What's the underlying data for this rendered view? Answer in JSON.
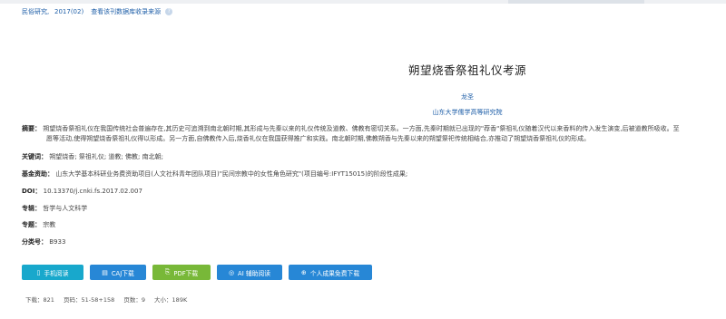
{
  "source": {
    "journal": "民俗研究",
    "issue": "2017(02)",
    "link": "查看该刊数据库收录来源"
  },
  "paper": {
    "title": "朔望烧香祭祖礼仪考源",
    "author": "龙圣",
    "affiliation": "山东大学儒学高等研究院"
  },
  "abstract": {
    "label": "摘要：",
    "line1": "朔望烧香祭祖礼仪在我国传统社会普遍存在,其历史可追溯到南北朝时期,其形成与先秦以来的礼仪传统及道教、佛教有密切关系。一方面,先秦时期就已出现的\"荐香\"祭祖礼仪随着汉代以来香料的传入发生演变,后被道教所吸收。至",
    "line2": "愿等活动,使得朔望烧香祭祖礼仪得以形成。另一方面,自佛教传入后,烧香礼仪在我国获得推广和实践。南北朝时期,佛教朔香与先秦以来的朔望祭祀传统相结合,亦推动了朔望烧香祭祖礼仪的形成。"
  },
  "keywords": {
    "label": "关键词：",
    "items": [
      "朔望烧香;",
      "祭祖礼仪;",
      "道教;",
      "佛教;",
      "南北朝;"
    ]
  },
  "fund": {
    "label": "基金资助：",
    "value": "山东大学基本科研业务费资助项目(人文社科青年团队项目)\"民间宗教中的女性角色研究\"(项目编号:IFYT15015)的阶段性成果;"
  },
  "doi": {
    "label": "DOI：",
    "value": "10.13370/j.cnki.fs.2017.02.007"
  },
  "topic": {
    "label": "专辑：",
    "value": "哲学与人文科学"
  },
  "subject": {
    "label": "专题：",
    "value": "宗教"
  },
  "clc": {
    "label": "分类号：",
    "value": "B933"
  },
  "actions": {
    "mobile": "手机阅读",
    "caj": "CAJ下载",
    "pdf": "PDF下载",
    "ai": "AI 辅助阅读",
    "personal": "个人成果免费下载"
  },
  "stats": {
    "downloads": "下载：821",
    "pages": "页码：51-58+158",
    "page_count": "页数：9",
    "size": "大小：189K"
  },
  "colors": {
    "link": "#1f5fa8",
    "teal": "#18a8cc",
    "blue": "#2787d6",
    "green": "#78b838"
  },
  "icons": {
    "help": "help-circle-icon",
    "mobile": "mobile-icon",
    "caj": "book-icon",
    "pdf": "pdf-icon",
    "ai": "ai-icon",
    "personal": "person-icon"
  }
}
